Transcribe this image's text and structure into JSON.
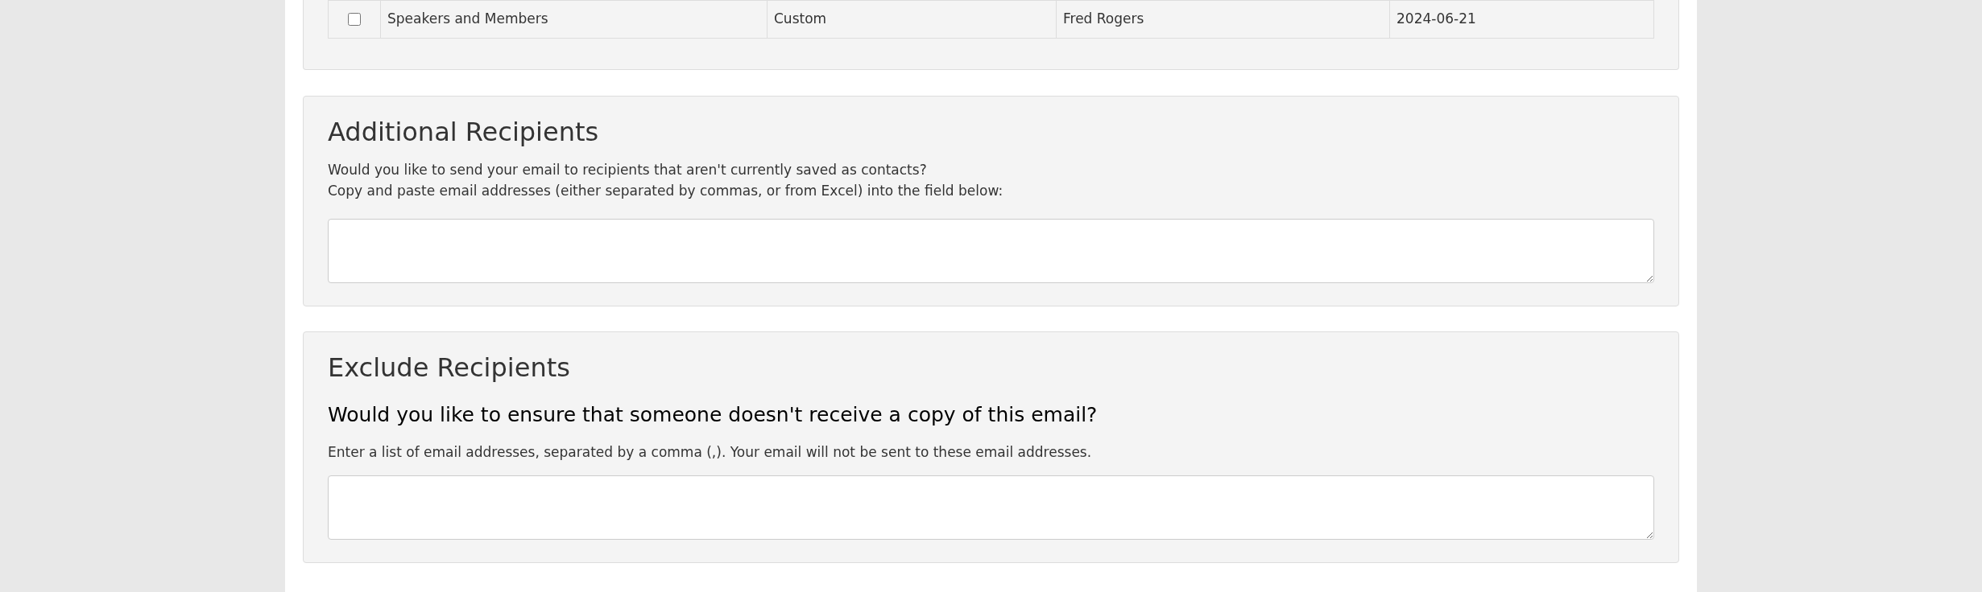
{
  "contact_table": {
    "rows": [
      {
        "checked": false,
        "cells": [
          "Speakers and Members",
          "Custom",
          "Fred Rogers",
          "2024-06-21"
        ]
      }
    ]
  },
  "additional_recipients": {
    "title": "Additional Recipients",
    "lines": [
      "Would you like to send your email to recipients that aren't currently saved as contacts?",
      "Copy and paste email addresses (either separated by commas, or from Excel) into the field below:"
    ]
  },
  "exclude_recipients": {
    "title": "Exclude Recipients",
    "question": "Would you like to ensure that someone doesn't receive a copy of this email?",
    "help": "Enter a list of email addresses, separated by a comma (,). Your email will not be sent to these email addresses."
  }
}
